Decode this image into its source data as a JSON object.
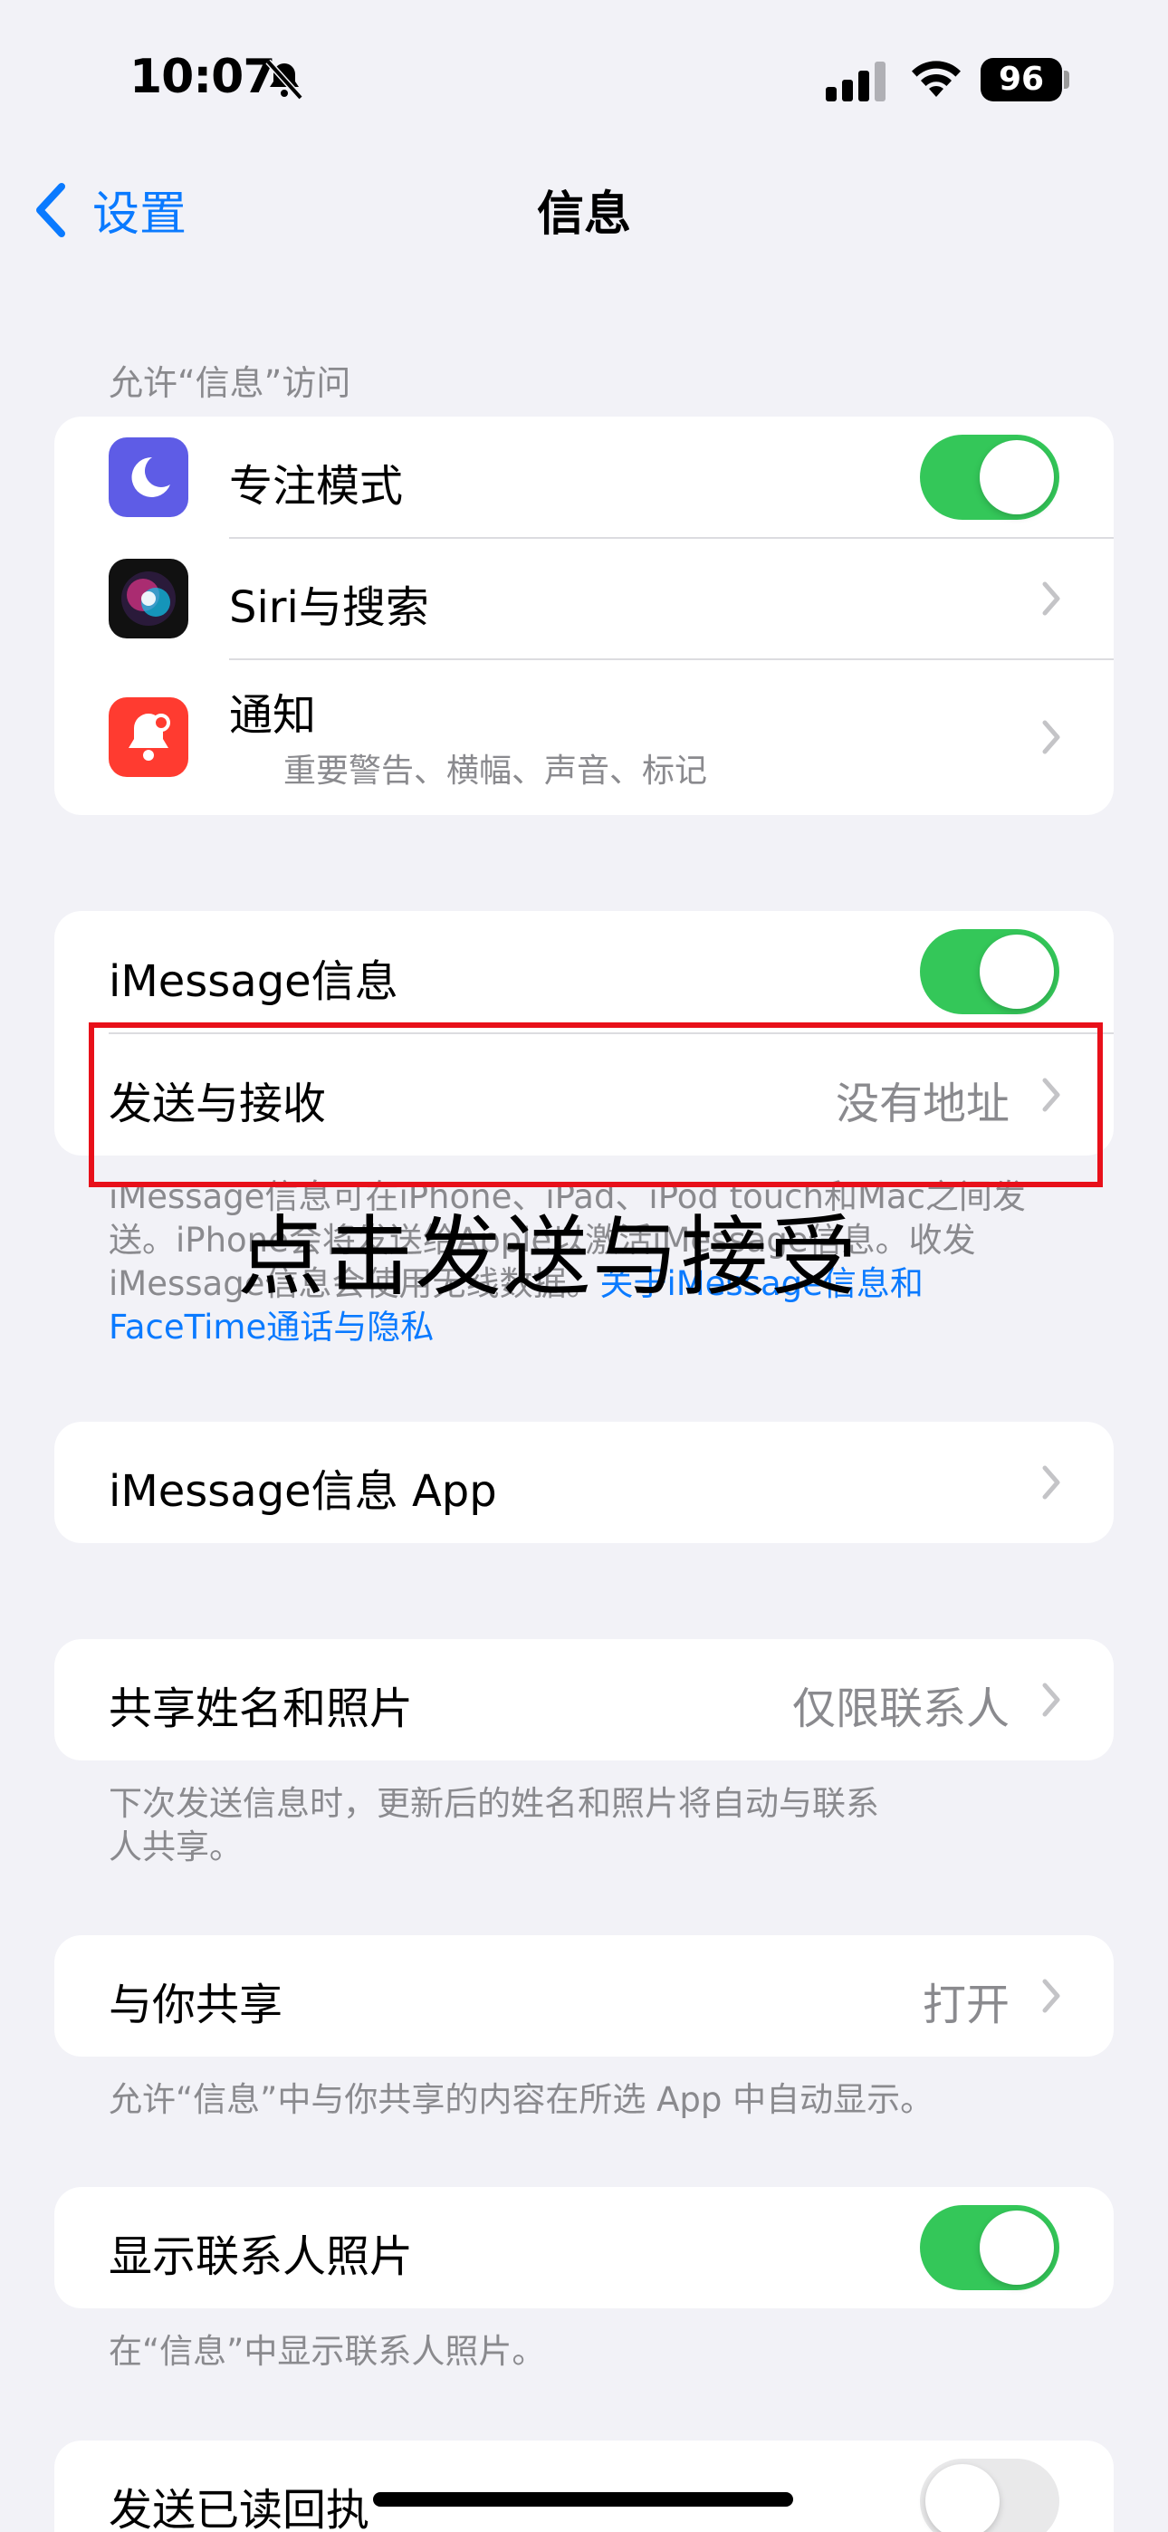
{
  "status_bar": {
    "time": "10:07",
    "battery": "96"
  },
  "nav": {
    "back_label": "设置",
    "title": "信息"
  },
  "section_access": {
    "header": "允许“信息”访问",
    "items": [
      {
        "label": "专注模式",
        "icon": "moon-icon",
        "toggle": true
      },
      {
        "label": "Siri与搜索",
        "icon": "siri-icon"
      },
      {
        "label": "通知",
        "sublabel": "重要警告、横幅、声音、标记",
        "icon": "bell-icon"
      }
    ]
  },
  "section_imessage": {
    "items": [
      {
        "label": "iMessage信息",
        "toggle": true
      },
      {
        "label": "发送与接收",
        "value": "没有地址"
      }
    ],
    "footer_text": "iMessage信息可在iPhone、iPad、iPod touch和Mac之间发送。iPhone会将发送给Apple以激活iMessage信息。收发iMessage信息会使用无线数据。",
    "footer_link": "关于iMessage信息和FaceTime通话与隐私"
  },
  "section_apps": {
    "label": "iMessage信息 App"
  },
  "section_share_name": {
    "label": "共享姓名和照片",
    "value": "仅限联系人",
    "footer": "下次发送信息时，更新后的姓名和照片将自动与联系人共享。"
  },
  "section_shared_with_you": {
    "label": "与你共享",
    "value": "打开",
    "footer": "允许“信息”中与你共享的内容在所选 App 中自动显示。"
  },
  "section_contact_photos": {
    "label": "显示联系人照片",
    "toggle": true,
    "footer": "在“信息”中显示联系人照片。"
  },
  "section_read_receipts": {
    "label": "发送已读回执",
    "toggle": false
  },
  "annotation": {
    "text": "点击发送与接受",
    "color": "#e8101a"
  },
  "colors": {
    "accent": "#0a7aff",
    "toggle_on": "#34c759",
    "background": "#f2f2f7"
  }
}
